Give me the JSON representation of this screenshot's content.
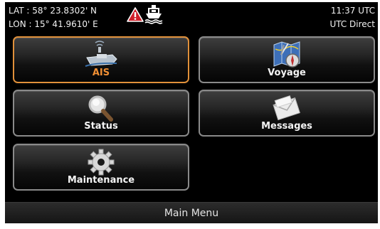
{
  "header": {
    "lat": "LAT : 58° 23.8302' N",
    "lon": "LON : 15° 41.9610' E",
    "time": "11:37 UTC",
    "utc_source": "UTC Direct",
    "alert_icon": "warning-triangle-icon",
    "ship_icon": "ship-icon"
  },
  "menu": {
    "ais": {
      "label": "AIS",
      "icon": "ais-satellite-ship-icon",
      "selected": true
    },
    "voyage": {
      "label": "Voyage",
      "icon": "voyage-map-compass-icon"
    },
    "status": {
      "label": "Status",
      "icon": "magnifier-icon"
    },
    "messages": {
      "label": "Messages",
      "icon": "envelope-icon"
    },
    "maintenance": {
      "label": "Maintenance",
      "icon": "gear-icon"
    }
  },
  "footer": {
    "title": "Main Menu"
  },
  "colors": {
    "accent": "#f08f34",
    "alert": "#d0202a",
    "background": "#000000"
  }
}
